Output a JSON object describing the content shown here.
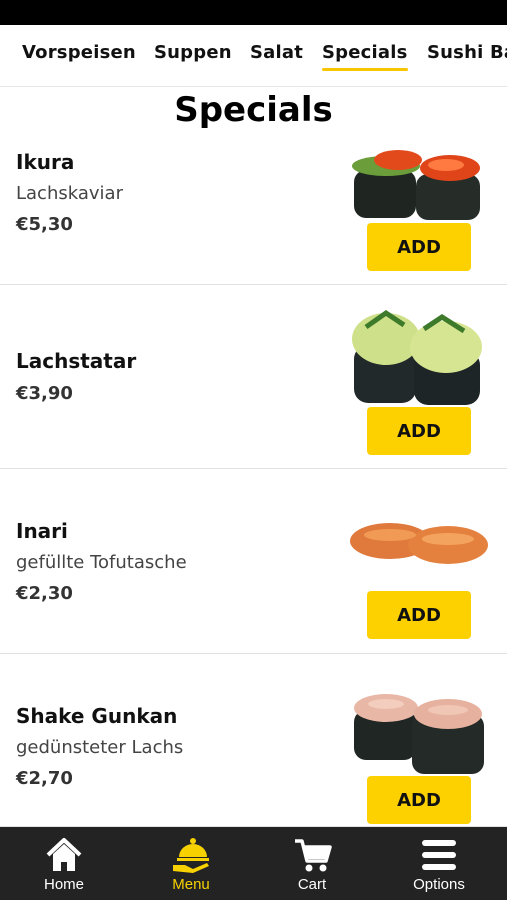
{
  "tabs": [
    {
      "label": "Vorspeisen"
    },
    {
      "label": "Suppen"
    },
    {
      "label": "Salat"
    },
    {
      "label": "Specials",
      "active": true
    },
    {
      "label": "Sushi Ba"
    }
  ],
  "section_title": "Specials",
  "items": [
    {
      "name": "Ikura",
      "description": "Lachskaviar",
      "price": "€5,30",
      "button": "ADD"
    },
    {
      "name": "Lachstatar",
      "description": "",
      "price": "€3,90",
      "button": "ADD"
    },
    {
      "name": "Inari",
      "description": "gefüllte Tofutasche",
      "price": "€2,30",
      "button": "ADD"
    },
    {
      "name": "Shake Gunkan",
      "description": "gedünsteter Lachs",
      "price": "€2,70",
      "button": "ADD"
    }
  ],
  "bottom_nav": [
    {
      "label": "Home",
      "icon": "home-icon"
    },
    {
      "label": "Menu",
      "icon": "waiter-bell-icon",
      "active": true
    },
    {
      "label": "Cart",
      "icon": "cart-icon"
    },
    {
      "label": "Options",
      "icon": "hamburger-menu-icon"
    }
  ],
  "colors": {
    "accent": "#fdd000",
    "nav_bg": "#232323",
    "active_nav": "#f7d200"
  }
}
